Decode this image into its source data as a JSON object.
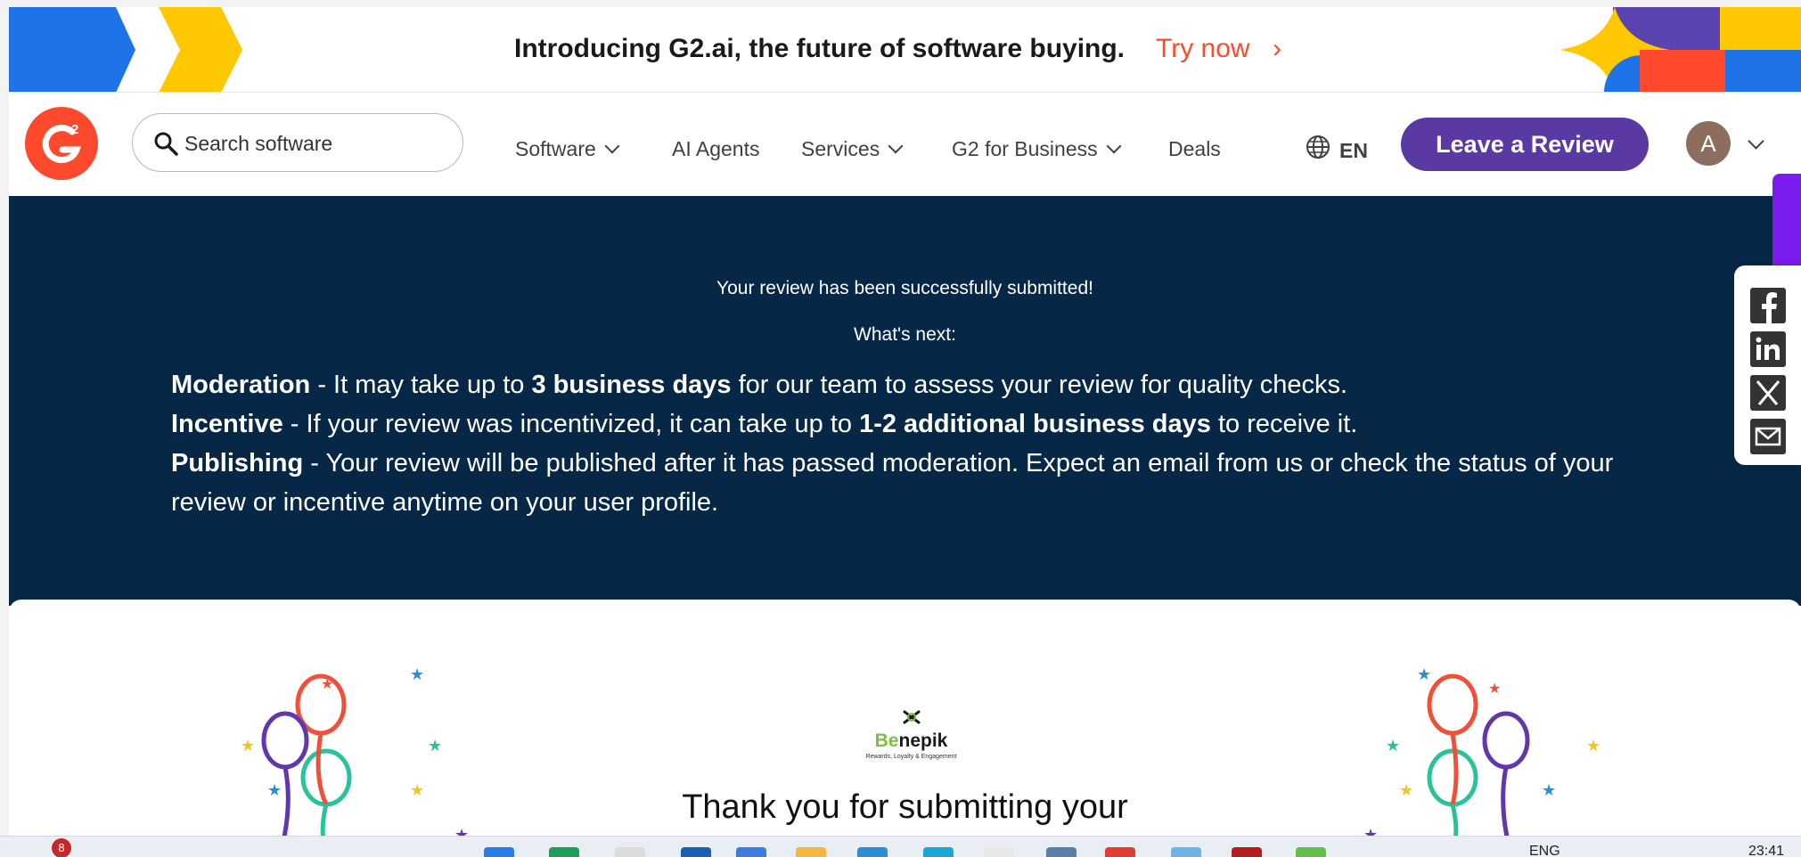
{
  "promo": {
    "text": "Introducing G2.ai, the future of software buying.",
    "link": "Try now",
    "chevron": "›"
  },
  "nav": {
    "logo": "G2",
    "search_placeholder": "Search software",
    "items": [
      "Software",
      "AI Agents",
      "Services",
      "G2 for Business",
      "Deals"
    ],
    "language": "EN",
    "cta": "Leave a Review",
    "avatar_initial": "A"
  },
  "hero": {
    "status": "Your review has been successfully submitted!",
    "next": "What's next:",
    "moderation": {
      "label": "Moderation",
      "pre": " - It may take up to ",
      "bold": "3 business days",
      "post": " for our team to assess your review for quality checks."
    },
    "incentive": {
      "label": "Incentive",
      "pre": " - If your review was incentivized, it can take up to ",
      "bold": "1-2 additional business days",
      "post": " to receive it."
    },
    "publishing": {
      "label": "Publishing",
      "text": " - Your review will be published after it has passed moderation. Expect an email from us or check the status of your review or incentive anytime on your user profile."
    }
  },
  "card": {
    "brand_prefix": "Be",
    "brand_suffix": "nepik",
    "brand_tagline": "Rewards, Loyalty & Engagement",
    "thanks": "Thank you for submitting your"
  },
  "share": {
    "icons": [
      "facebook-icon",
      "linkedin-icon",
      "x-icon",
      "email-icon"
    ]
  },
  "taskbar": {
    "badge": "8",
    "lang": "ENG",
    "time": "23:41"
  },
  "colors": {
    "brand_red": "#ff492c",
    "purple": "#5a39a2",
    "hero_bg": "#062846",
    "benepik_green": "#7cbf3a"
  }
}
